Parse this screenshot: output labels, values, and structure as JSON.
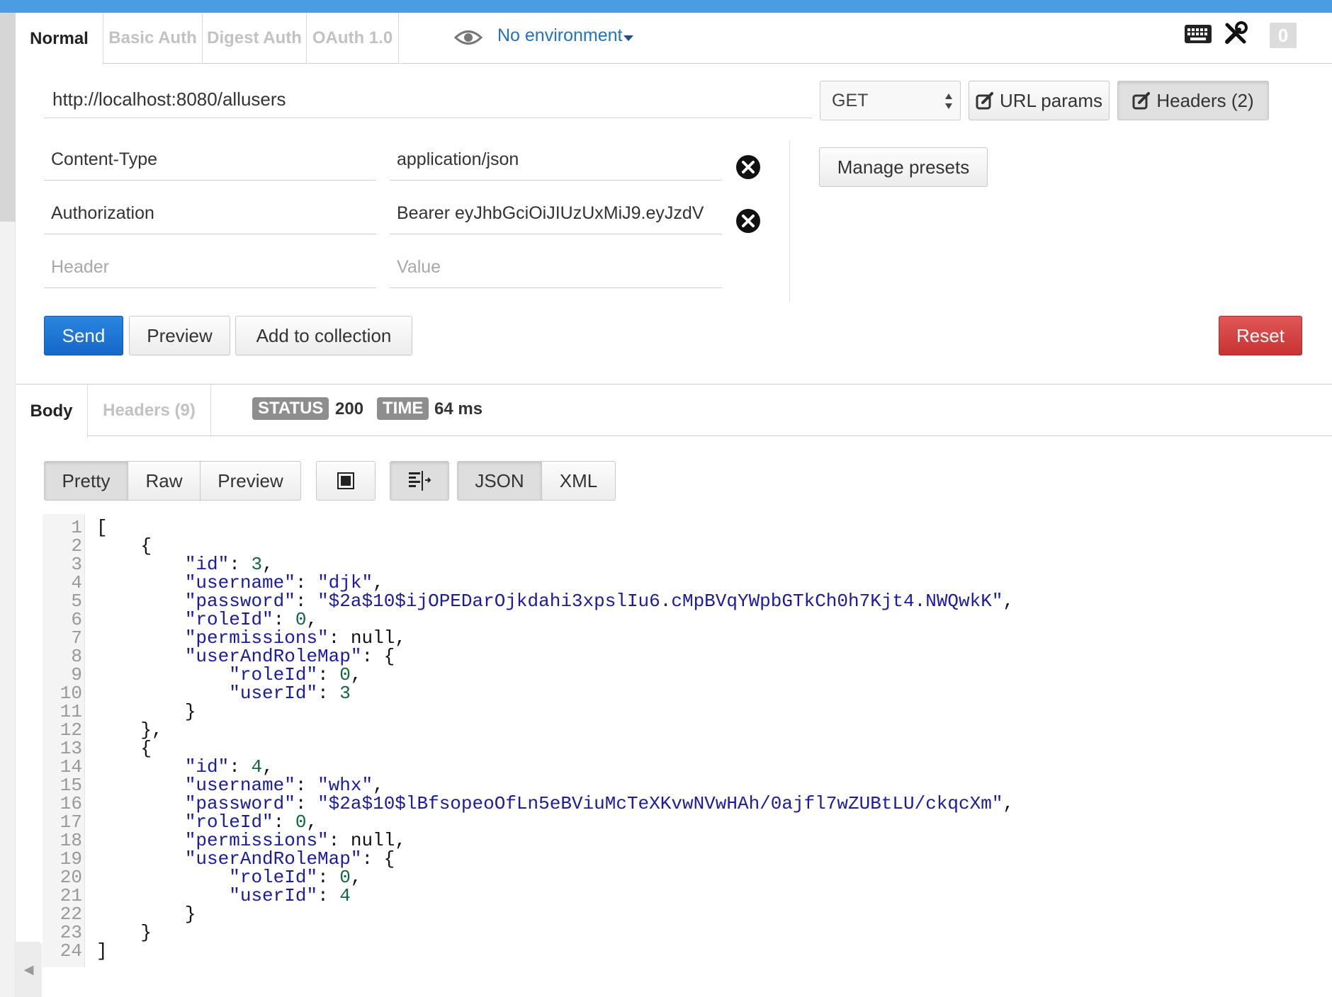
{
  "auth_tabs": [
    "Normal",
    "Basic Auth",
    "Digest Auth",
    "OAuth 1.0"
  ],
  "environment": "No environment",
  "counter": "0",
  "request": {
    "url": "http://localhost:8080/allusers",
    "method": "GET",
    "url_params_label": "URL params",
    "headers_label": "Headers (2)"
  },
  "headers": [
    {
      "name": "Content-Type",
      "value": "application/json"
    },
    {
      "name": "Authorization",
      "value": "Bearer eyJhbGciOiJIUzUxMiJ9.eyJzdV"
    }
  ],
  "header_placeholders": {
    "name": "Header",
    "value": "Value"
  },
  "manage_presets_label": "Manage presets",
  "actions": {
    "send": "Send",
    "preview": "Preview",
    "add_to_collection": "Add to collection",
    "reset": "Reset"
  },
  "response": {
    "tabs": [
      "Body",
      "Headers (9)"
    ],
    "status_label": "STATUS",
    "status_value": "200",
    "time_label": "TIME",
    "time_value": "64 ms"
  },
  "view_modes": [
    "Pretty",
    "Raw",
    "Preview"
  ],
  "formats": [
    "JSON",
    "XML"
  ],
  "code_lines": [
    "[",
    "    {",
    "        \"id\": 3,",
    "        \"username\": \"djk\",",
    "        \"password\": \"$2a$10$ijOPEDarOjkdahi3xpslIu6.cMpBVqYWpbGTkCh0h7Kjt4.NWQwkK\",",
    "        \"roleId\": 0,",
    "        \"permissions\": null,",
    "        \"userAndRoleMap\": {",
    "            \"roleId\": 0,",
    "            \"userId\": 3",
    "        }",
    "    },",
    "    {",
    "        \"id\": 4,",
    "        \"username\": \"whx\",",
    "        \"password\": \"$2a$10$lBfsopeoOfLn5eBViuMcTeXKvwNVwHAh/0ajfl7wZUBtLU/ckqcXm\",",
    "        \"roleId\": 0,",
    "        \"permissions\": null,",
    "        \"userAndRoleMap\": {",
    "            \"roleId\": 0,",
    "            \"userId\": 4",
    "        }",
    "    }",
    "]"
  ],
  "colors": {
    "accent": "#1f72c4",
    "send": "#1667c9",
    "reset": "#c83232",
    "json_key": "#1a1aa6",
    "json_number": "#116644"
  }
}
